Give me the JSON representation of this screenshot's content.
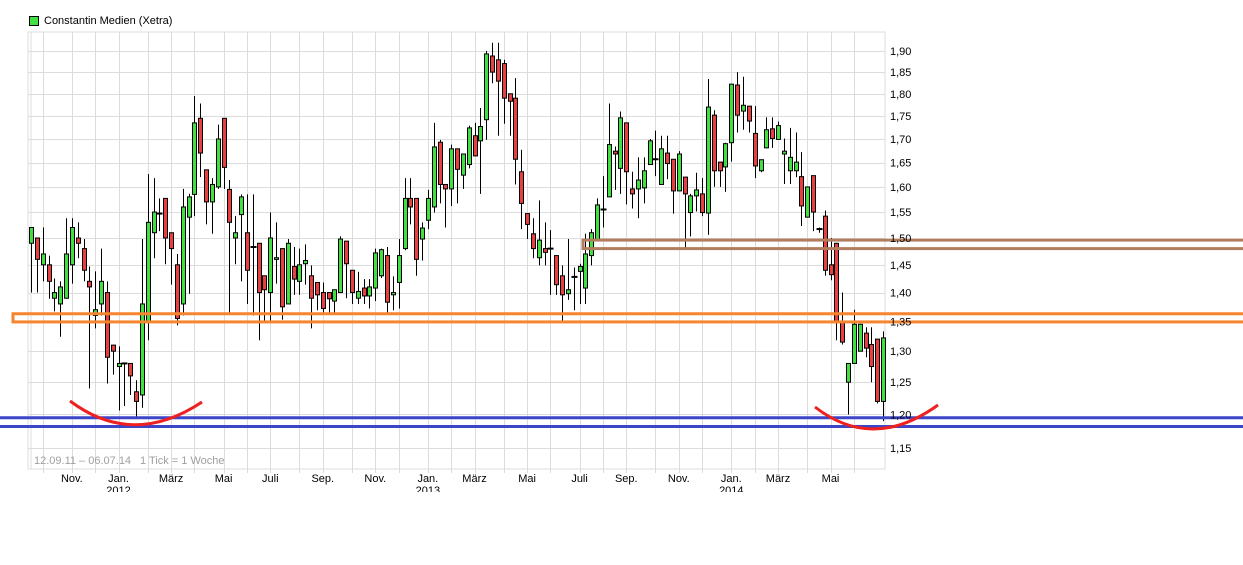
{
  "legend": {
    "label": "Constantin Medien (Xetra)",
    "color": "#40e040"
  },
  "footer": {
    "range": "12.09.11 – 06.07.14",
    "tick": "1 Tick = 1 Woche"
  },
  "chart_data": {
    "type": "candlestick",
    "title": "Constantin Medien (Xetra)",
    "start_date": "2011-09-12",
    "end_date": "2014-07-06",
    "interval": "1 Woche",
    "y_scale": "log",
    "ylim": [
      1.12,
      1.946
    ],
    "grid": true,
    "legend_position": "top-left",
    "colors": {
      "up": "#40e040",
      "down": "#e84040",
      "outline": "#000000",
      "grid": "#dcdcdc",
      "support": "#3d46c8",
      "resistance_orange": "#f5862f",
      "resistance_brown": "#b07d5e",
      "arc": "#ee2020"
    },
    "y_ticks": [
      "1,90",
      "1,85",
      "1,80",
      "1,75",
      "1,70",
      "1,65",
      "1,60",
      "1,55",
      "1,50",
      "1,45",
      "1,40",
      "1,35",
      "1,30",
      "1,25",
      "1,20",
      "1,15"
    ],
    "y_tick_values": [
      1.9,
      1.85,
      1.8,
      1.75,
      1.7,
      1.65,
      1.6,
      1.55,
      1.5,
      1.45,
      1.4,
      1.35,
      1.3,
      1.25,
      1.2,
      1.15
    ],
    "x_grid_months": [
      "2011-10-01",
      "2011-11-01",
      "2011-12-01",
      "2012-01-01",
      "2012-02-01",
      "2012-03-01",
      "2012-04-01",
      "2012-05-01",
      "2012-06-01",
      "2012-07-01",
      "2012-08-01",
      "2012-09-01",
      "2012-10-01",
      "2012-11-01",
      "2012-12-01",
      "2013-01-01",
      "2013-02-01",
      "2013-03-01",
      "2013-04-01",
      "2013-05-01",
      "2013-06-01",
      "2013-07-01",
      "2013-08-01",
      "2013-09-01",
      "2013-10-01",
      "2013-11-01",
      "2013-12-01",
      "2014-01-01",
      "2014-02-01",
      "2014-03-01",
      "2014-04-01",
      "2014-05-01",
      "2014-06-01"
    ],
    "x_ticks": [
      {
        "date": "2011-11-01",
        "label": "Nov.",
        "year": ""
      },
      {
        "date": "2012-01-01",
        "label": "Jan.",
        "year": "2012"
      },
      {
        "date": "2012-03-01",
        "label": "März",
        "year": ""
      },
      {
        "date": "2012-05-01",
        "label": "Mai",
        "year": ""
      },
      {
        "date": "2012-07-01",
        "label": "Juli",
        "year": ""
      },
      {
        "date": "2012-09-01",
        "label": "Sep.",
        "year": ""
      },
      {
        "date": "2012-11-01",
        "label": "Nov.",
        "year": ""
      },
      {
        "date": "2013-01-01",
        "label": "Jan.",
        "year": "2013"
      },
      {
        "date": "2013-03-01",
        "label": "März",
        "year": ""
      },
      {
        "date": "2013-05-01",
        "label": "Mai",
        "year": ""
      },
      {
        "date": "2013-07-01",
        "label": "Juli",
        "year": ""
      },
      {
        "date": "2013-09-01",
        "label": "Sep.",
        "year": ""
      },
      {
        "date": "2013-11-01",
        "label": "Nov.",
        "year": ""
      },
      {
        "date": "2014-01-01",
        "label": "Jan.",
        "year": "2014"
      },
      {
        "date": "2014-03-01",
        "label": "März",
        "year": ""
      },
      {
        "date": "2014-05-01",
        "label": "Mai",
        "year": ""
      }
    ],
    "levels": {
      "support": [
        1.195,
        1.182
      ],
      "resistance_orange": [
        1.363,
        1.349
      ],
      "resistance_brown": [
        1.496,
        1.48
      ]
    },
    "ohlc_fields": [
      "open",
      "high",
      "low",
      "close"
    ],
    "ohlc": [
      [
        1.49,
        1.52,
        1.4,
        1.52
      ],
      [
        1.5,
        1.5,
        1.4,
        1.46
      ],
      [
        1.45,
        1.52,
        1.42,
        1.47
      ],
      [
        1.45,
        1.467,
        1.389,
        1.42
      ],
      [
        1.39,
        1.425,
        1.367,
        1.4
      ],
      [
        1.38,
        1.42,
        1.324,
        1.41
      ],
      [
        1.39,
        1.538,
        1.389,
        1.47
      ],
      [
        1.45,
        1.538,
        1.416,
        1.52
      ],
      [
        1.5,
        1.53,
        1.462,
        1.49
      ],
      [
        1.48,
        1.498,
        1.42,
        1.44
      ],
      [
        1.42,
        1.447,
        1.24,
        1.41
      ],
      [
        1.36,
        1.438,
        1.338,
        1.37
      ],
      [
        1.38,
        1.48,
        1.36,
        1.42
      ],
      [
        1.4,
        1.42,
        1.248,
        1.29
      ],
      [
        1.31,
        1.31,
        1.262,
        1.3
      ],
      [
        1.275,
        1.308,
        1.206,
        1.28
      ],
      [
        1.28,
        1.28,
        1.213,
        1.28
      ],
      [
        1.28,
        1.28,
        1.23,
        1.26
      ],
      [
        1.235,
        1.253,
        1.195,
        1.22
      ],
      [
        1.23,
        1.498,
        1.21,
        1.38
      ],
      [
        1.35,
        1.626,
        1.318,
        1.53
      ],
      [
        1.51,
        1.618,
        1.462,
        1.55
      ],
      [
        1.547,
        1.577,
        1.513,
        1.547
      ],
      [
        1.577,
        1.577,
        1.451,
        1.5
      ],
      [
        1.51,
        1.51,
        1.414,
        1.48
      ],
      [
        1.45,
        1.47,
        1.343,
        1.355
      ],
      [
        1.38,
        1.596,
        1.36,
        1.56
      ],
      [
        1.54,
        1.586,
        1.398,
        1.58
      ],
      [
        1.585,
        1.795,
        1.542,
        1.735
      ],
      [
        1.745,
        1.778,
        1.62,
        1.67
      ],
      [
        1.635,
        1.635,
        1.526,
        1.57
      ],
      [
        1.57,
        1.618,
        1.508,
        1.605
      ],
      [
        1.6,
        1.731,
        1.596,
        1.7
      ],
      [
        1.745,
        1.745,
        1.596,
        1.64
      ],
      [
        1.595,
        1.614,
        1.363,
        1.53
      ],
      [
        1.5,
        1.542,
        1.451,
        1.51
      ],
      [
        1.545,
        1.585,
        1.42,
        1.58
      ],
      [
        1.51,
        1.585,
        1.38,
        1.44
      ],
      [
        1.483,
        1.585,
        1.36,
        1.483
      ],
      [
        1.49,
        1.49,
        1.318,
        1.4
      ],
      [
        1.43,
        1.43,
        1.35,
        1.405
      ],
      [
        1.4,
        1.549,
        1.35,
        1.5
      ],
      [
        1.46,
        1.53,
        1.416,
        1.463
      ],
      [
        1.48,
        1.48,
        1.353,
        1.375
      ],
      [
        1.38,
        1.498,
        1.38,
        1.49
      ],
      [
        1.447,
        1.483,
        1.396,
        1.424
      ],
      [
        1.42,
        1.48,
        1.396,
        1.45
      ],
      [
        1.452,
        1.488,
        1.414,
        1.458
      ],
      [
        1.43,
        1.449,
        1.338,
        1.39
      ],
      [
        1.418,
        1.418,
        1.369,
        1.396
      ],
      [
        1.4,
        1.418,
        1.362,
        1.372
      ],
      [
        1.4,
        1.4,
        1.362,
        1.389
      ],
      [
        1.385,
        1.405,
        1.365,
        1.405
      ],
      [
        1.4,
        1.503,
        1.4,
        1.498
      ],
      [
        1.494,
        1.494,
        1.39,
        1.452
      ],
      [
        1.44,
        1.44,
        1.38,
        1.4
      ],
      [
        1.39,
        1.437,
        1.38,
        1.402
      ],
      [
        1.408,
        1.424,
        1.38,
        1.394
      ],
      [
        1.394,
        1.424,
        1.372,
        1.41
      ],
      [
        1.408,
        1.48,
        1.385,
        1.472
      ],
      [
        1.43,
        1.48,
        1.426,
        1.478
      ],
      [
        1.467,
        1.483,
        1.362,
        1.383
      ],
      [
        1.396,
        1.429,
        1.369,
        1.4
      ],
      [
        1.418,
        1.498,
        1.372,
        1.467
      ],
      [
        1.48,
        1.618,
        1.477,
        1.577
      ],
      [
        1.577,
        1.618,
        1.526,
        1.56
      ],
      [
        1.577,
        1.577,
        1.43,
        1.46
      ],
      [
        1.498,
        1.53,
        1.458,
        1.519
      ],
      [
        1.534,
        1.594,
        1.517,
        1.577
      ],
      [
        1.56,
        1.735,
        1.549,
        1.683
      ],
      [
        1.693,
        1.698,
        1.567,
        1.605
      ],
      [
        1.605,
        1.605,
        1.52,
        1.596
      ],
      [
        1.596,
        1.688,
        1.562,
        1.679
      ],
      [
        1.679,
        1.679,
        1.567,
        1.636
      ],
      [
        1.624,
        1.668,
        1.596,
        1.668
      ],
      [
        1.646,
        1.729,
        1.638,
        1.724
      ],
      [
        1.707,
        1.735,
        1.664,
        1.664
      ],
      [
        1.696,
        1.768,
        1.586,
        1.727
      ],
      [
        1.742,
        1.9,
        1.698,
        1.893
      ],
      [
        1.888,
        1.92,
        1.824,
        1.85
      ],
      [
        1.879,
        1.92,
        1.707,
        1.829
      ],
      [
        1.87,
        1.879,
        1.733,
        1.79
      ],
      [
        1.8,
        1.8,
        1.707,
        1.783
      ],
      [
        1.79,
        1.836,
        1.605,
        1.657
      ],
      [
        1.631,
        1.677,
        1.517,
        1.567
      ],
      [
        1.547,
        1.547,
        1.498,
        1.526
      ],
      [
        1.508,
        1.538,
        1.462,
        1.48
      ],
      [
        1.463,
        1.573,
        1.449,
        1.496
      ],
      [
        1.48,
        1.53,
        1.449,
        1.473
      ],
      [
        1.48,
        1.515,
        1.396,
        1.48
      ],
      [
        1.467,
        1.467,
        1.396,
        1.414
      ],
      [
        1.43,
        1.449,
        1.35,
        1.396
      ],
      [
        1.398,
        1.498,
        1.387,
        1.405
      ],
      [
        1.428,
        1.445,
        1.369,
        1.428
      ],
      [
        1.438,
        1.452,
        1.38,
        1.447
      ],
      [
        1.408,
        1.508,
        1.38,
        1.47
      ],
      [
        1.467,
        1.517,
        1.449,
        1.51
      ],
      [
        1.496,
        1.577,
        1.494,
        1.564
      ],
      [
        1.555,
        1.622,
        1.52,
        1.557
      ],
      [
        1.58,
        1.778,
        1.58,
        1.688
      ],
      [
        1.674,
        1.684,
        1.594,
        1.668
      ],
      [
        1.638,
        1.76,
        1.586,
        1.746
      ],
      [
        1.735,
        1.735,
        1.565,
        1.631
      ],
      [
        1.596,
        1.631,
        1.557,
        1.586
      ],
      [
        1.596,
        1.661,
        1.538,
        1.614
      ],
      [
        1.598,
        1.661,
        1.567,
        1.633
      ],
      [
        1.646,
        1.7,
        1.646,
        1.696
      ],
      [
        1.657,
        1.718,
        1.622,
        1.657
      ],
      [
        1.605,
        1.707,
        1.605,
        1.679
      ],
      [
        1.67,
        1.707,
        1.616,
        1.648
      ],
      [
        1.657,
        1.657,
        1.547,
        1.592
      ],
      [
        1.592,
        1.674,
        1.592,
        1.668
      ],
      [
        1.62,
        1.62,
        1.482,
        1.586
      ],
      [
        1.549,
        1.586,
        1.503,
        1.582
      ],
      [
        1.582,
        1.629,
        1.551,
        1.594
      ],
      [
        1.586,
        1.618,
        1.542,
        1.549
      ],
      [
        1.548,
        1.834,
        1.506,
        1.77
      ],
      [
        1.752,
        1.763,
        1.6,
        1.633
      ],
      [
        1.651,
        1.651,
        1.6,
        1.633
      ],
      [
        1.641,
        1.692,
        1.59,
        1.69
      ],
      [
        1.692,
        1.822,
        1.652,
        1.822
      ],
      [
        1.82,
        1.85,
        1.714,
        1.752
      ],
      [
        1.761,
        1.839,
        1.72,
        1.774
      ],
      [
        1.772,
        1.772,
        1.714,
        1.739
      ],
      [
        1.712,
        1.772,
        1.618,
        1.643
      ],
      [
        1.633,
        1.656,
        1.63,
        1.656
      ],
      [
        1.681,
        1.747,
        1.681,
        1.72
      ],
      [
        1.722,
        1.747,
        1.681,
        1.701
      ],
      [
        1.699,
        1.738,
        1.699,
        1.729
      ],
      [
        1.668,
        1.701,
        1.606,
        1.674
      ],
      [
        1.633,
        1.724,
        1.606,
        1.661
      ],
      [
        1.633,
        1.714,
        1.62,
        1.651
      ],
      [
        1.621,
        1.672,
        1.523,
        1.562
      ],
      [
        1.54,
        1.6,
        1.54,
        1.6
      ],
      [
        1.623,
        1.623,
        1.513,
        1.55
      ],
      [
        1.517,
        1.52,
        1.51,
        1.517
      ],
      [
        1.542,
        1.553,
        1.43,
        1.44
      ],
      [
        1.45,
        1.5,
        1.422,
        1.432
      ],
      [
        1.49,
        1.49,
        1.318,
        1.35
      ],
      [
        1.35,
        1.4,
        1.311,
        1.315
      ],
      [
        1.25,
        1.28,
        1.2,
        1.28
      ],
      [
        1.28,
        1.37,
        1.28,
        1.345
      ],
      [
        1.3,
        1.345,
        1.3,
        1.345
      ],
      [
        1.33,
        1.34,
        1.29,
        1.305
      ],
      [
        1.311,
        1.34,
        1.25,
        1.275
      ],
      [
        1.32,
        1.32,
        1.217,
        1.22
      ],
      [
        1.22,
        1.333,
        1.19,
        1.322
      ]
    ]
  }
}
